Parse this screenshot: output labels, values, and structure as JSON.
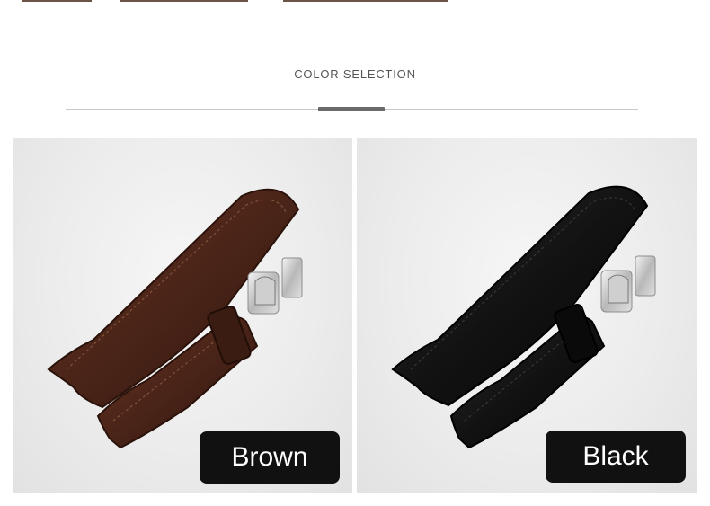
{
  "section": {
    "title": "COLOR SELECTION"
  },
  "options": [
    {
      "label": "Brown",
      "color": "#4a2418"
    },
    {
      "label": "Black",
      "color": "#111111"
    }
  ],
  "colors": {
    "divider": "#c8c8c8",
    "accent": "#6a6a6a",
    "label_bg": "#111111"
  }
}
